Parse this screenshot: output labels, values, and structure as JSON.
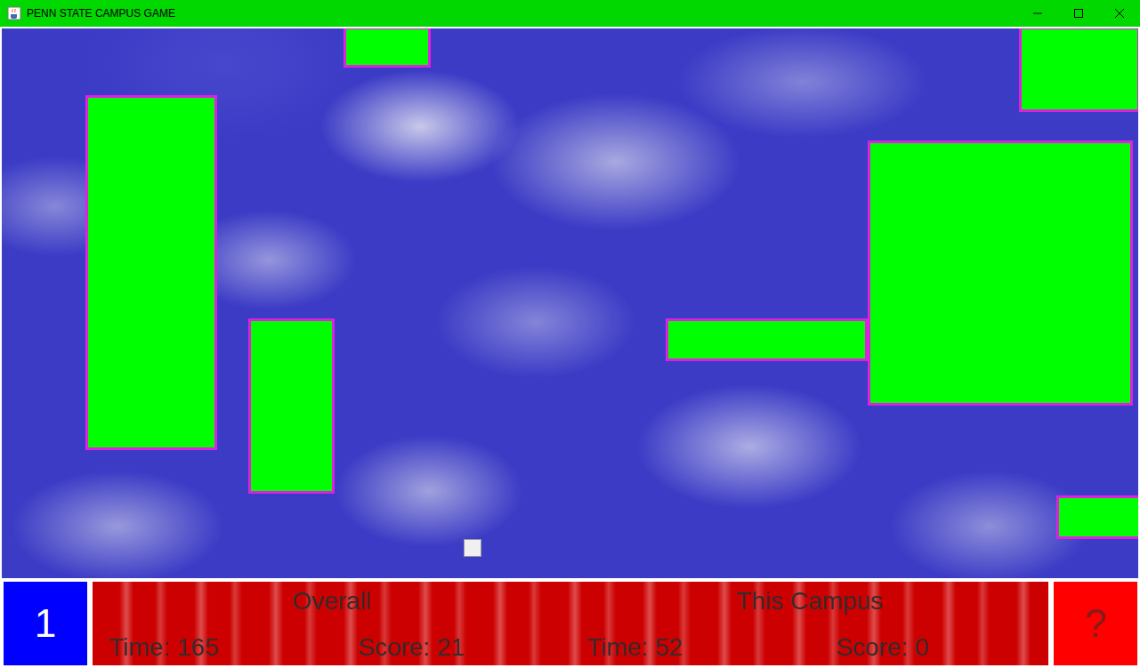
{
  "window": {
    "title": "PENN STATE CAMPUS GAME"
  },
  "board": {
    "obstacles": [
      {
        "kind": "block"
      },
      {
        "kind": "block"
      },
      {
        "kind": "block"
      },
      {
        "kind": "block"
      },
      {
        "kind": "block"
      },
      {
        "kind": "block"
      },
      {
        "kind": "block"
      }
    ]
  },
  "status": {
    "campus_number": "1",
    "help": "?",
    "groups": [
      {
        "heading": "Overall",
        "time": "Time: 165",
        "score": "Score: 21"
      },
      {
        "heading": "This Campus",
        "time": "Time: 52",
        "score": "Score: 0"
      }
    ]
  }
}
